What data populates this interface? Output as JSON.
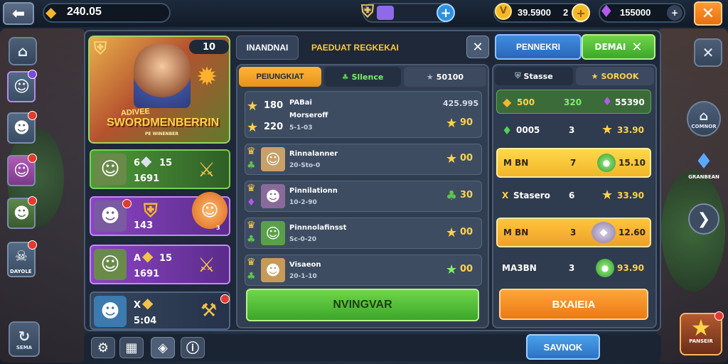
{
  "topbar": {
    "gold": "240.05",
    "coins": "39.5900",
    "gems": "155000",
    "coins_sep": "2"
  },
  "heroCard": {
    "level": "10",
    "title": "SWORDMENBERRIN",
    "subtitle": "ADIVEE",
    "caption": "PE WINENBER"
  },
  "heroRows": [
    {
      "num": "15",
      "stat": "1691",
      "prefix": "6"
    },
    {
      "num": "14",
      "stat": "143",
      "badge": "3"
    },
    {
      "num": "15",
      "stat": "1691",
      "prefix": "A"
    },
    {
      "num": "X",
      "stat": "5:04"
    }
  ],
  "tabs": {
    "main": "INANDNAI",
    "secondary": "PAEDUAT REGKEKAI"
  },
  "subtabs": [
    "PEIUNGKIAT",
    "Sllence",
    "50100"
  ],
  "rows": [
    {
      "line1": "PABai",
      "line2": "Morseroff",
      "line3": "5-1-03",
      "v1": "180",
      "v2": "220",
      "right": "425.995",
      "score": "90"
    },
    {
      "line1": "Rinnalanner",
      "line2": "20-Sto-0",
      "score": "00"
    },
    {
      "line1": "Pinnilationn",
      "line2": "10-2-90",
      "score": "30"
    },
    {
      "line1": "Pinnnolafinsst",
      "line2": "Sc-0-20",
      "score": "00"
    },
    {
      "line1": "Visaeon",
      "line2": "20-1-10",
      "score": "00"
    }
  ],
  "mainButton": "NVINGVAR",
  "rightTabs": {
    "a": "PENNEKRI",
    "b": "DEMAI",
    "c": "Stasse",
    "d": "SOROOK"
  },
  "rightRows": [
    {
      "a": "500",
      "b": "320",
      "c": "55390"
    },
    {
      "a": "0005",
      "b": "3",
      "c": "33.90"
    },
    {
      "a": "M BN",
      "b": "7",
      "c": "15.10"
    },
    {
      "a": "Stasero",
      "b": "6",
      "c": "33.90",
      "x": "X"
    },
    {
      "a": "M BN",
      "b": "3",
      "c": "12.60"
    },
    {
      "a": "MA3BN",
      "b": "3",
      "c": "93.90"
    }
  ],
  "rightButton": "BXAIEIA",
  "bottomButton": "SAVNOK",
  "leftLabels": {
    "shop": "SEMA",
    "frames": "PANSEIR",
    "right1": "COMNOR",
    "right2": "GRANBEAN",
    "sideL": "DAYOLE"
  },
  "colors": {
    "accent": "#2e90e0",
    "green": "#3cb83a",
    "orange": "#f29b1f",
    "yellow": "#f5c632"
  }
}
